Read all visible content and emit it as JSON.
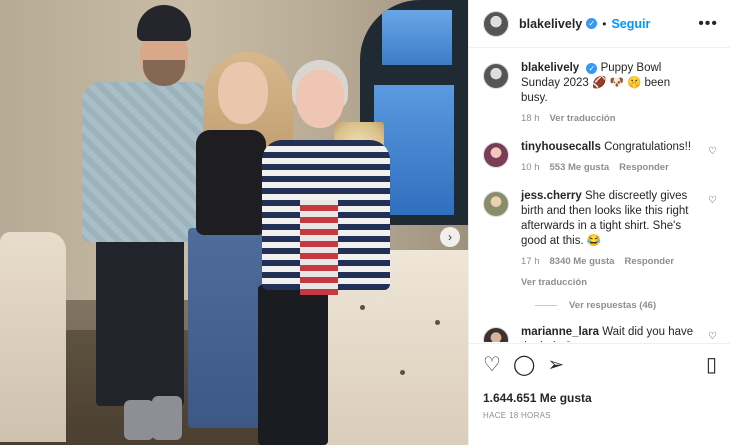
{
  "header": {
    "username": "blakelively",
    "verified_glyph": "✓",
    "separator": "•",
    "follow_label": "Seguir",
    "more_glyph": "•••"
  },
  "photo": {
    "next_glyph": "›"
  },
  "caption": {
    "username": "blakelively",
    "text": "Puppy Bowl Sunday 2023 🏈 🐶 🤫 been busy.",
    "time": "18 h",
    "translate_label": "Ver traducción"
  },
  "comments": [
    {
      "username": "tinyhousecalls",
      "text": "Congratulations!!",
      "time": "10 h",
      "likes": "553 Me gusta",
      "reply_label": "Responder"
    },
    {
      "username": "jess.cherry",
      "text": "She discreetly gives birth and then looks like this right afterwards in a tight shirt. She's good at this. 😂",
      "time": "17 h",
      "likes": "8340 Me gusta",
      "reply_label": "Responder",
      "translate_label": "Ver traducción",
      "view_replies_label": "Ver respuestas (46)"
    },
    {
      "username": "marianne_lara",
      "text": "Wait did you have the baby?"
    }
  ],
  "actions": {
    "like_glyph": "♡",
    "comment_glyph": "◯",
    "share_glyph": "➢",
    "save_glyph": "▯",
    "comment_like_glyph": "♡",
    "likes_count": "1.644.651 Me gusta",
    "timestamp": "HACE 18 HORAS"
  },
  "colors": {
    "accent": "#0095f6",
    "verified": "#3897f0",
    "muted": "#8e8e8e"
  }
}
